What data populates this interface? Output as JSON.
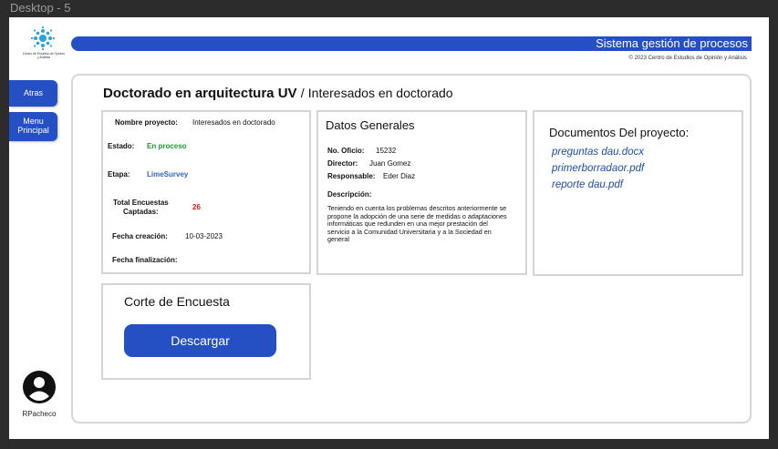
{
  "frame": {
    "label": "Desktop - 5"
  },
  "brand": {
    "logo_text": "Centro de Estudios de Opinión y Análisis"
  },
  "header": {
    "title": "Sistema gestión de procesos",
    "copyright": "© 2023 Centro de Estudios de Opinión y Análisis"
  },
  "sidebar": {
    "back_label": "Atras",
    "menu_line1": "Menu",
    "menu_line2": "Principal",
    "user_name": "RPacheco"
  },
  "page": {
    "title": "Doctorado en arquitectura UV",
    "separator": "/",
    "subtitle": "Interesados en doctorado"
  },
  "project": {
    "name_label": "Nombre proyecto:",
    "name_value": "Interesados en doctorado",
    "status_label": "Estado:",
    "status_value": "En proceso",
    "stage_label": "Etapa:",
    "stage_value": "LimeSurvey",
    "total_label_1": "Total Encuestas",
    "total_label_2": "Captadas:",
    "total_value": "26",
    "created_label": "Fecha creación:",
    "created_value": "10-03-2023",
    "finished_label": "Fecha finalización:",
    "finished_value": ""
  },
  "general": {
    "title": "Datos Generales",
    "oficio_label": "No. Oficio:",
    "oficio_value": "15232",
    "director_label": "Director:",
    "director_value": "Juan Gomez",
    "responsable_label": "Responsable:",
    "responsable_value": "Eder Diaz",
    "description_label": "Descripción:",
    "description_value": "Teniendo en cuenta los problemas descritos anteriormente se propone la adopción de una serie de medidas o adaptaciones informáticas que redunden en una mejor prestación del servicio a la Comunidad Universitaria y a la Sociedad en general"
  },
  "documents": {
    "title": "Documentos Del proyecto:",
    "files": [
      "preguntas dau.docx",
      "primerborradaor.pdf",
      "reporte dau.pdf"
    ]
  },
  "cut": {
    "title": "Corte de Encuesta",
    "button_label": "Descargar"
  },
  "colors": {
    "primary": "#2550c4",
    "status_green": "#1e9a33",
    "stage_blue": "#3266c8",
    "count_red": "#e21c1c",
    "link_blue": "#1f4fa6"
  }
}
